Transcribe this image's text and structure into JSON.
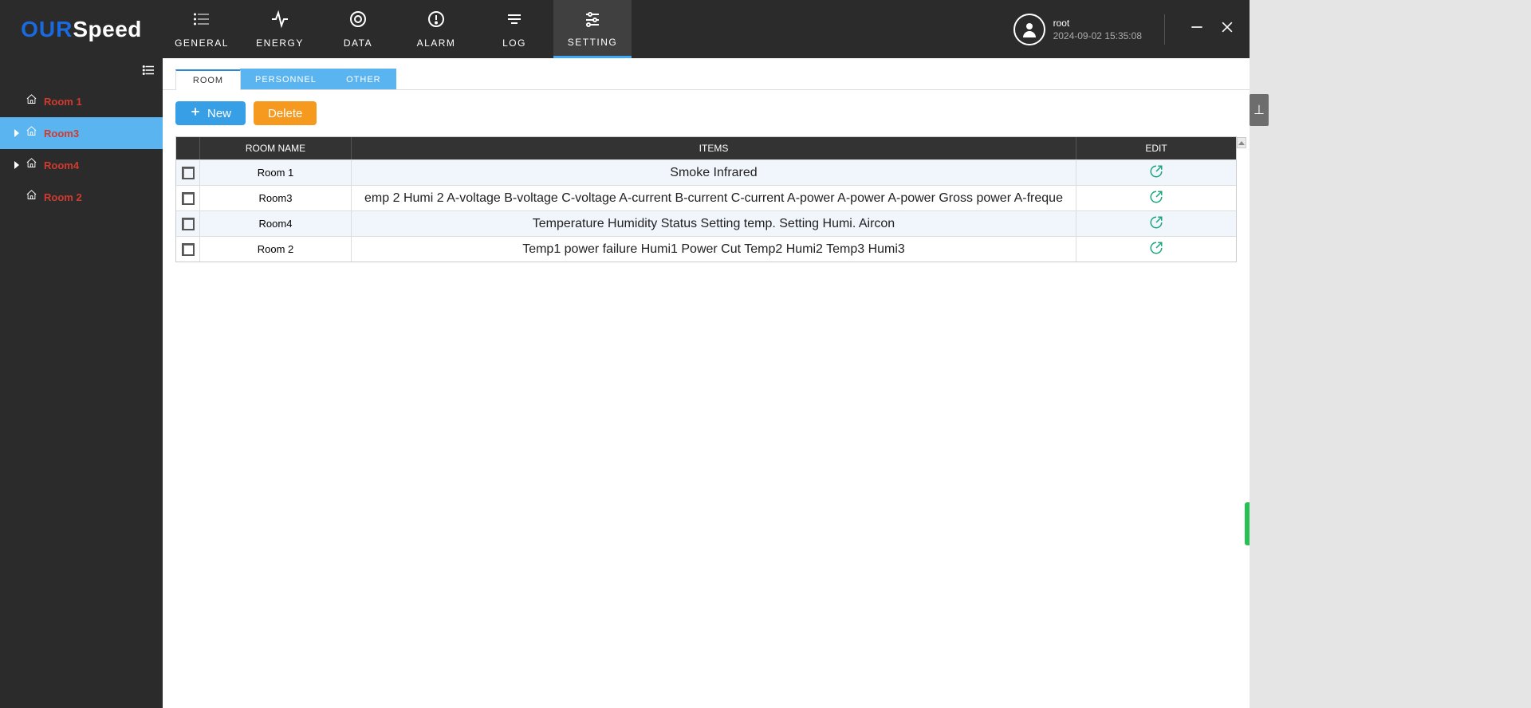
{
  "brand": {
    "part1": "OUR",
    "part2": "Speed"
  },
  "nav": [
    {
      "id": "general",
      "label": "GENERAL",
      "icon": "list",
      "active": false
    },
    {
      "id": "energy",
      "label": "ENERGY",
      "icon": "activity",
      "active": false
    },
    {
      "id": "data",
      "label": "DATA",
      "icon": "target",
      "active": false
    },
    {
      "id": "alarm",
      "label": "ALARM",
      "icon": "alert",
      "active": false
    },
    {
      "id": "log",
      "label": "LOG",
      "icon": "lines",
      "active": false
    },
    {
      "id": "setting",
      "label": "SETTING",
      "icon": "sliders",
      "active": true
    }
  ],
  "user": {
    "name": "root",
    "time": "2024-09-02 15:35:08"
  },
  "sidebar": {
    "rooms": [
      {
        "name": "Room 1",
        "selected": false,
        "hasChildren": false
      },
      {
        "name": "Room3",
        "selected": true,
        "hasChildren": true
      },
      {
        "name": "Room4",
        "selected": false,
        "hasChildren": true
      },
      {
        "name": "Room 2",
        "selected": false,
        "hasChildren": false
      }
    ]
  },
  "tabs": [
    {
      "id": "room",
      "label": "ROOM",
      "active": true
    },
    {
      "id": "personnel",
      "label": "PERSONNEL",
      "active": false
    },
    {
      "id": "other",
      "label": "OTHER",
      "active": false
    }
  ],
  "actions": {
    "new": "New",
    "delete": "Delete"
  },
  "table": {
    "headers": {
      "name": "ROOM NAME",
      "items": "ITEMS",
      "edit": "EDIT"
    },
    "rows": [
      {
        "name": "Room 1",
        "items": "Smoke Infrared"
      },
      {
        "name": "Room3",
        "items": "emp 2 Humi 2 A-voltage B-voltage C-voltage A-current B-current C-current A-power A-power A-power Gross power A-freque"
      },
      {
        "name": "Room4",
        "items": "Temperature Humidity Status Setting temp. Setting Humi. Aircon"
      },
      {
        "name": "Room 2",
        "items": "Temp1 power failure Humi1 Power Cut  Temp2 Humi2 Temp3 Humi3"
      }
    ]
  }
}
